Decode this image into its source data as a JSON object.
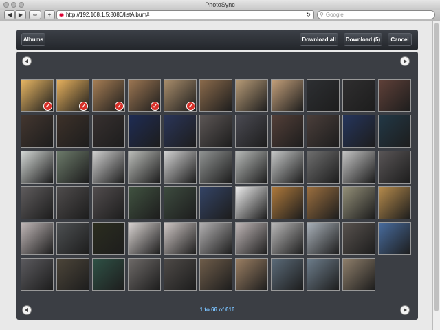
{
  "window": {
    "title": "PhotoSync"
  },
  "toolbar": {
    "back_icon": "back-arrow-icon",
    "forward_icon": "forward-arrow-icon",
    "url": "http://192.168.1.5:8080/listAlbum#",
    "search_placeholder": "Google"
  },
  "app": {
    "albums_label": "Albums",
    "download_all_label": "Download all",
    "download_label": "Download (5)",
    "cancel_label": "Cancel",
    "page_info": "1 to 66 of 616",
    "prev_icon": "prev-page-icon",
    "next_icon": "next-page-icon"
  },
  "grid": {
    "thumb_colors": [
      "#e8b663",
      "#e7b15d",
      "#a77e54",
      "#9c7652",
      "#a98d6b",
      "#8a6a4b",
      "#b79b77",
      "#c4a07a",
      "#2d2f32",
      "#2f2e2f",
      "#5f4038",
      "#43362f",
      "#3d3129",
      "#37302f",
      "#1e2c54",
      "#2a3558",
      "#5c5655",
      "#4a4a52",
      "#533f38",
      "#4a3e3a",
      "#25355c",
      "#223846",
      "#d2d6d4",
      "#6c7a6a",
      "#cfcfcf",
      "#babcb8",
      "#d2d2d2",
      "#8f9291",
      "#b6b9b7",
      "#c4c6c6",
      "#6e6e6e",
      "#c3c3c3",
      "#595556",
      "#5f5c5d",
      "#4f4c4c",
      "#524d4e",
      "#415341",
      "#3d4b3f",
      "#344466",
      "#ececec",
      "#b07a3c",
      "#9b6f3f",
      "#938f78",
      "#b68b4c",
      "#c0b7b7",
      "#4d5052",
      "#2b2d1e",
      "#d9d3d1",
      "#cfc7c5",
      "#b2b0b1",
      "#bfb6b6",
      "#b9b8b8",
      "#a9b1b9",
      "#58524e",
      "#486c9e",
      "#5b5a5e",
      "#4c4539",
      "#2f5246",
      "#6e6a68",
      "#4e4a47",
      "#6f5d4a",
      "#9b7f63",
      "#5b6b79",
      "#6d7d8b",
      "#8f7f6b"
    ],
    "selected": [
      0,
      1,
      2,
      3,
      4
    ]
  }
}
